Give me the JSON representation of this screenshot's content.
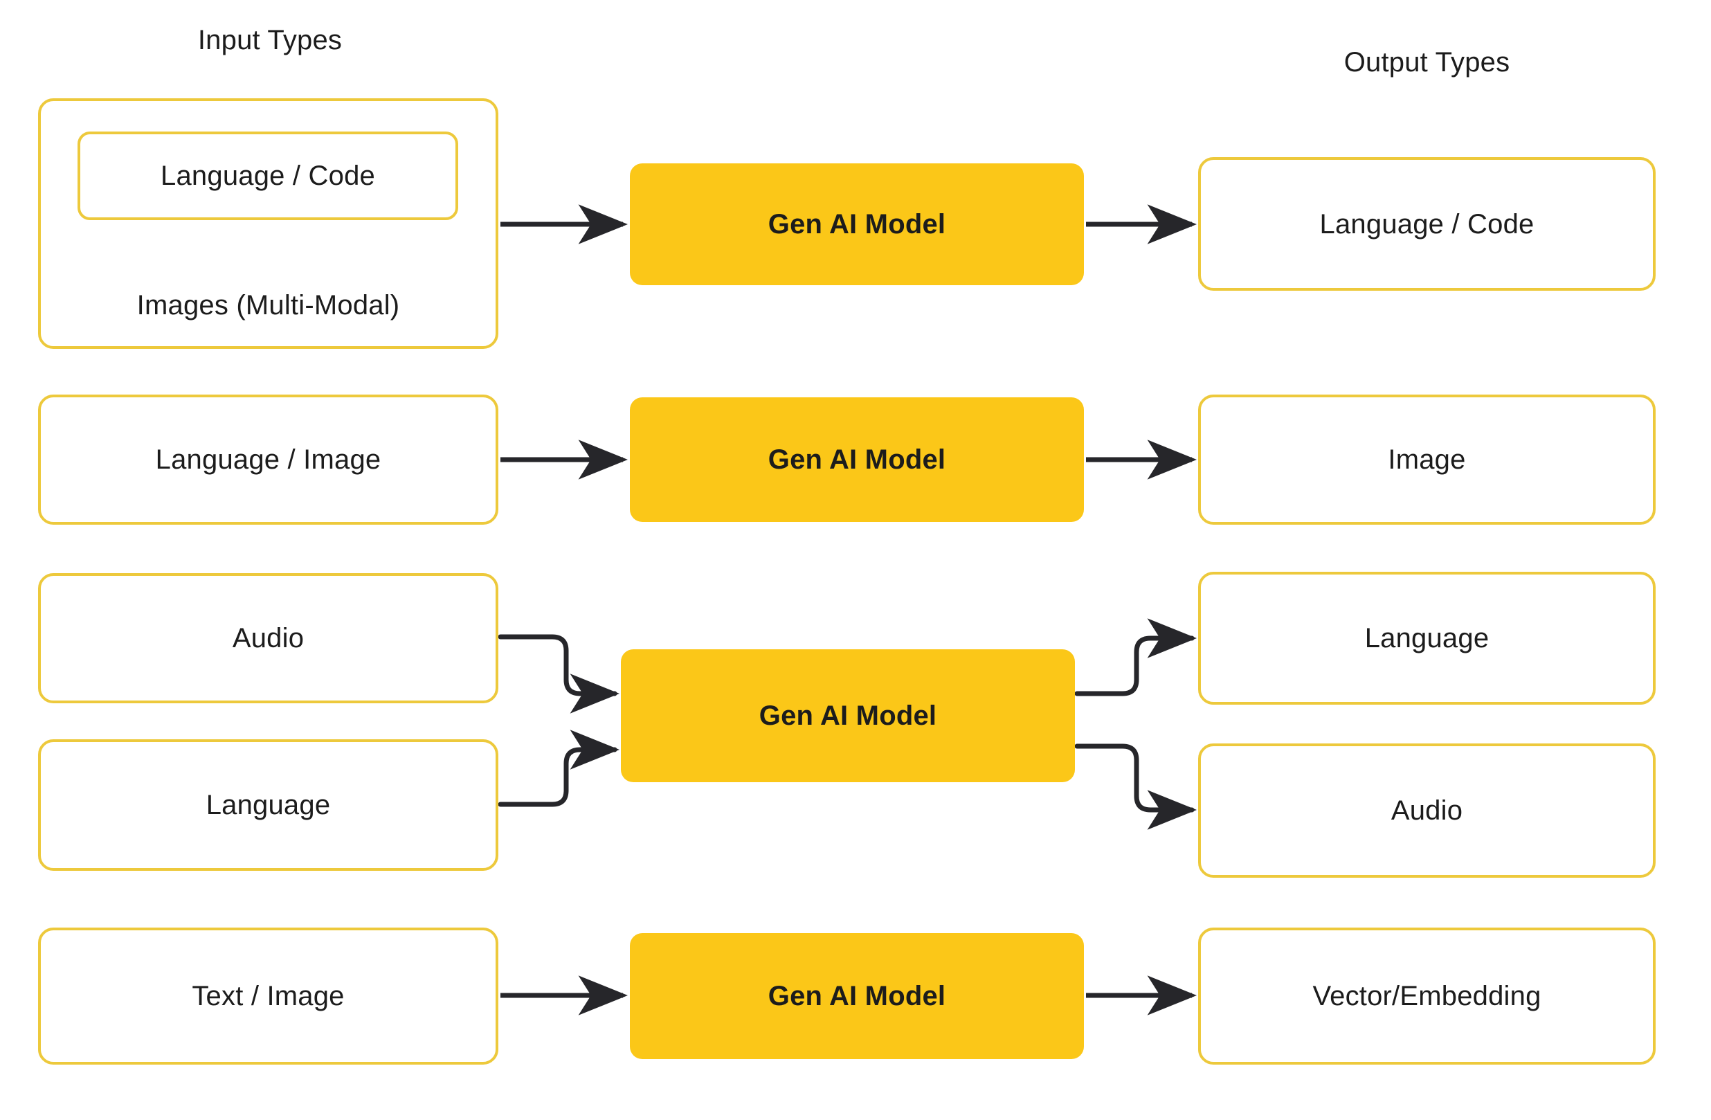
{
  "titles": {
    "input": "Input Types",
    "output": "Output Types"
  },
  "colors": {
    "model_fill": "#fbc718",
    "box_border": "#edc93c",
    "arrow": "#26262a",
    "text": "#1c1c1c",
    "background": "#ffffff"
  },
  "rows": [
    {
      "id": "row-1",
      "input_group_label": "Images (Multi-Modal)",
      "input_nested_label": "Language / Code",
      "model_label": "Gen AI Model",
      "outputs": [
        "Language / Code"
      ]
    },
    {
      "id": "row-2",
      "inputs": [
        "Language / Image"
      ],
      "model_label": "Gen AI Model",
      "outputs": [
        "Image"
      ]
    },
    {
      "id": "row-3",
      "inputs": [
        "Audio",
        "Language"
      ],
      "model_label": "Gen AI Model",
      "outputs": [
        "Language",
        "Audio"
      ]
    },
    {
      "id": "row-4",
      "inputs": [
        "Text / Image"
      ],
      "model_label": "Gen AI Model",
      "outputs": [
        "Vector/Embedding"
      ]
    }
  ],
  "icons": {
    "arrow": "arrow-right-icon",
    "elbow": "elbow-connector-icon"
  }
}
